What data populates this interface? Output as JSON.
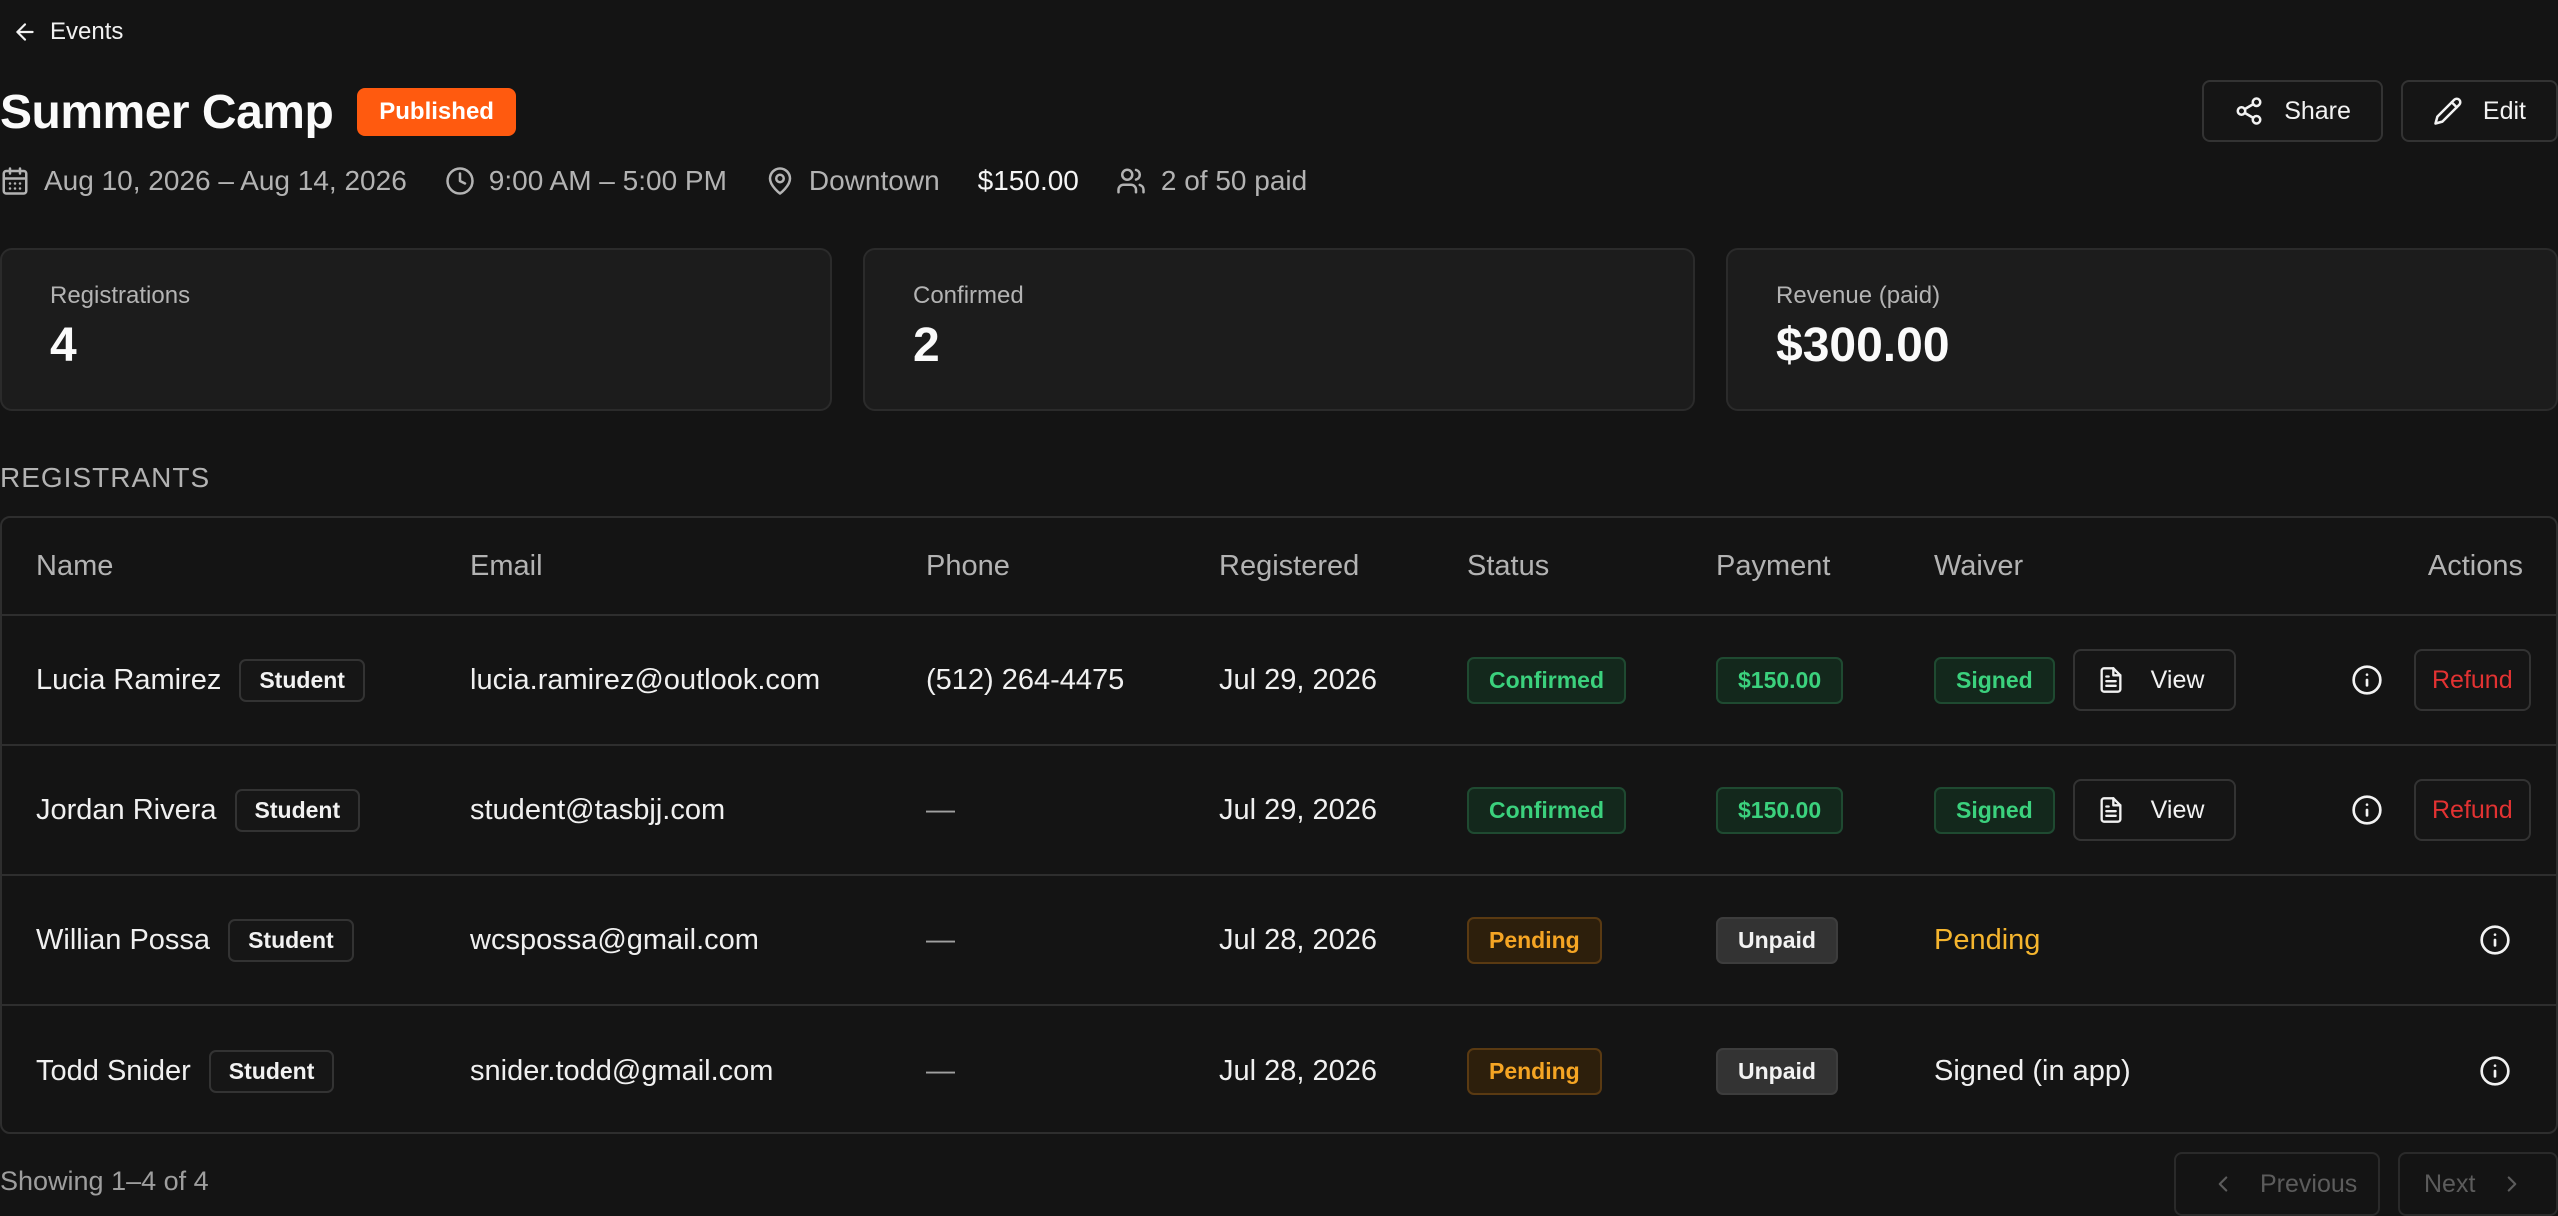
{
  "nav": {
    "back_label": "Events"
  },
  "event": {
    "title": "Summer Camp",
    "status": "Published",
    "dates": "Aug 10, 2026 – Aug 14, 2026",
    "time": "9:00 AM – 5:00 PM",
    "location": "Downtown",
    "price": "$150.00",
    "capacity": "2 of 50 paid"
  },
  "actions": {
    "share_label": "Share",
    "edit_label": "Edit"
  },
  "stats": [
    {
      "label": "Registrations",
      "value": "4"
    },
    {
      "label": "Confirmed",
      "value": "2"
    },
    {
      "label": "Revenue (paid)",
      "value": "$300.00"
    }
  ],
  "registrants": {
    "heading": "REGISTRANTS",
    "columns": [
      "Name",
      "Email",
      "Phone",
      "Registered",
      "Status",
      "Payment",
      "Waiver",
      "Actions"
    ],
    "rows": [
      {
        "name": "Lucia Ramirez",
        "role": "Student",
        "email": "lucia.ramirez@outlook.com",
        "phone": "(512) 264-4475",
        "registered": "Jul 29, 2026",
        "status": "Confirmed",
        "payment": "$150.00",
        "waiver": "Signed",
        "view_label": "View",
        "refund_label": "Refund"
      },
      {
        "name": "Jordan Rivera",
        "role": "Student",
        "email": "student@tasbjj.com",
        "phone": "—",
        "registered": "Jul 29, 2026",
        "status": "Confirmed",
        "payment": "$150.00",
        "waiver": "Signed",
        "view_label": "View",
        "refund_label": "Refund"
      },
      {
        "name": "Willian Possa",
        "role": "Student",
        "email": "wcspossa@gmail.com",
        "phone": "—",
        "registered": "Jul 28, 2026",
        "status": "Pending",
        "payment": "Unpaid",
        "waiver": "Pending"
      },
      {
        "name": "Todd Snider",
        "role": "Student",
        "email": "snider.todd@gmail.com",
        "phone": "—",
        "registered": "Jul 28, 2026",
        "status": "Pending",
        "payment": "Unpaid",
        "waiver": "Signed (in app)"
      }
    ]
  },
  "pagination": {
    "summary": "Showing 1–4 of 4",
    "previous_label": "Previous",
    "next_label": "Next"
  },
  "colors": {
    "accent": "#ff5a0f",
    "success": "#3bd17d",
    "warning": "#f5a524",
    "danger": "#e23232",
    "background": "#141414"
  }
}
